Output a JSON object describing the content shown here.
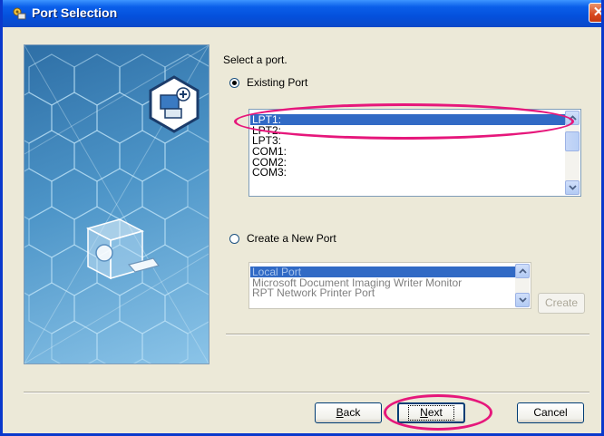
{
  "window": {
    "title": "Port Selection",
    "close_label": "✕"
  },
  "prompt": "Select a port.",
  "existing_port": {
    "label": "Existing Port",
    "selected": true,
    "items": [
      "LPT1:",
      "LPT2:",
      "LPT3:",
      "COM1:",
      "COM2:",
      "COM3:"
    ],
    "selected_item": "LPT1:"
  },
  "new_port": {
    "label": "Create a New Port",
    "selected": false,
    "items": [
      "Local Port",
      "Microsoft Document Imaging Writer Monitor",
      "RPT Network Printer Port"
    ],
    "selected_item": "Local Port",
    "create_label": "Create"
  },
  "footer": {
    "back_label": "Back",
    "back_mnemonic": "B",
    "next_label": "Next",
    "next_mnemonic": "N",
    "cancel_label": "Cancel"
  },
  "colors": {
    "highlight_circle": "#E6177B",
    "selection": "#316AC5",
    "titlebar": "#0A5FEA"
  }
}
